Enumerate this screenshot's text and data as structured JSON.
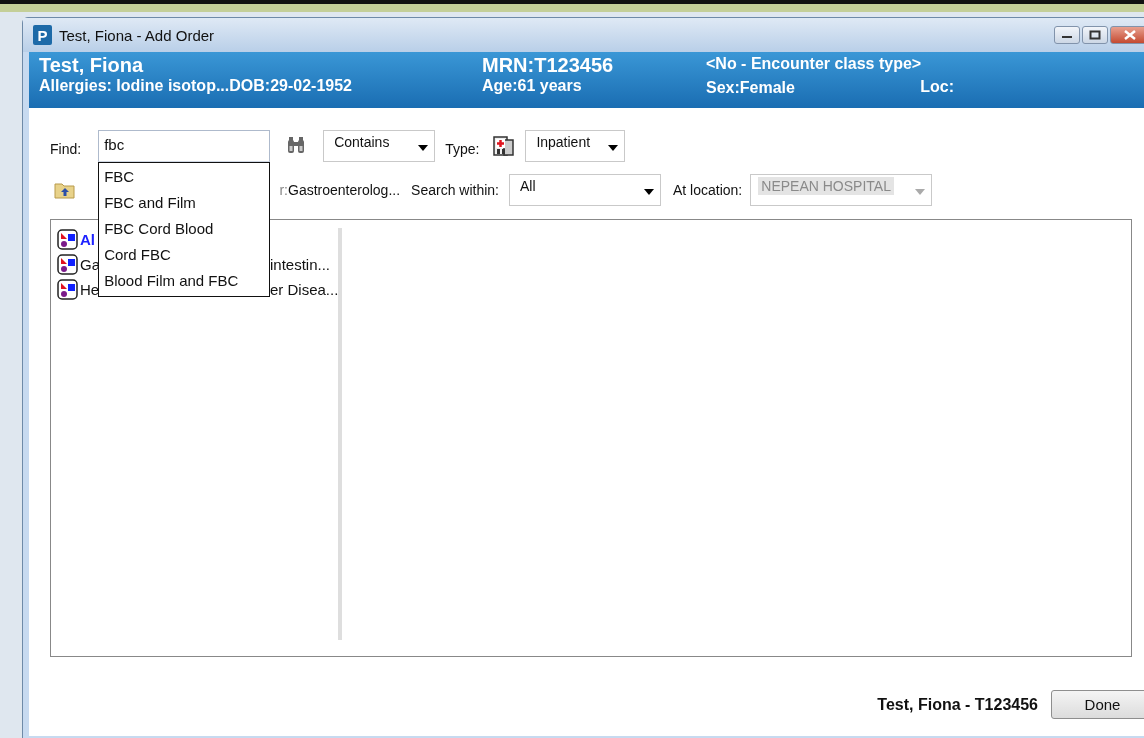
{
  "window": {
    "title": "Test, Fiona - Add Order",
    "icon_letter": "P"
  },
  "banner": {
    "name": "Test, Fiona",
    "allergies": "Allergies:  Iodine isotop...",
    "dob": "DOB:29-02-1952",
    "mrn": "MRN:T123456",
    "age": "Age:61 years",
    "encounter": "<No - Encounter class type>",
    "sex": "Sex:Female",
    "loc": "Loc:"
  },
  "find": {
    "label": "Find:",
    "value": "fbc",
    "match": "Contains",
    "type_label": "Type:",
    "type": "Inpatient"
  },
  "autocomplete": [
    "FBC",
    "FBC and Film",
    "FBC Cord Blood",
    "Cord FBC",
    "Blood Film and FBC"
  ],
  "folder_row": {
    "folder_prefix": "r:",
    "folder": "Gastroenterolog...",
    "search_within_label": "Search within:",
    "search_within": "All",
    "location_label": "At location:",
    "location": "NEPEAN HOSPITAL",
    "location_disabled": true
  },
  "tree": [
    {
      "label_start": "Al",
      "highlighted": true
    },
    {
      "label_start": "Ga",
      "label_end": "intestin...",
      "highlighted": false
    },
    {
      "label_start": "He",
      "label_end": "er Disea...",
      "highlighted": false
    }
  ],
  "footer": {
    "patient": "Test, Fiona - T123456",
    "done": "Done"
  }
}
